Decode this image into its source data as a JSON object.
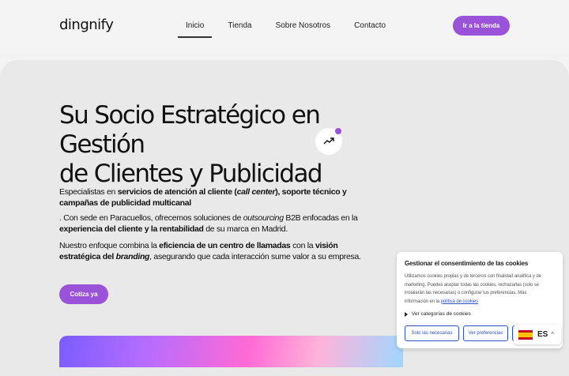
{
  "brand": {
    "logo": "dingnify",
    "accent": "#9a53d8"
  },
  "nav": {
    "items": [
      {
        "label": "Inicio",
        "active": true
      },
      {
        "label": "Tienda",
        "active": false
      },
      {
        "label": "Sobre Nosotros",
        "active": false
      },
      {
        "label": "Contacto",
        "active": false
      }
    ],
    "store_button": "Ir a la tienda"
  },
  "hero": {
    "title_line1": "Su Socio Estratégico en Gestión",
    "title_line2": "de Clientes y Publicidad",
    "trend_icon": "trending-up-icon",
    "p1": {
      "t1": "Especialistas en ",
      "b1": "servicios de atención al cliente (",
      "bi1": "call center",
      "b2": "), soporte técnico y campañas de publicidad multicanal"
    },
    "p2": {
      "t1": ". Con sede en Paracuellos, ofrecemos soluciones de ",
      "i1": "outsourcing",
      "t2": " B2B enfocadas en la ",
      "b1": "experiencia del cliente y la rentabilidad",
      "t3": " de su marca en Madrid."
    },
    "p3": {
      "t1": "Nuestro enfoque combina la ",
      "b1": "eficiencia de un centro de llamadas",
      "t2": " con la ",
      "b2": "visión estratégica del ",
      "bi1": "branding",
      "t3": ", asegurando que cada interacción sume valor a su empresa."
    },
    "cta": "Cotiza ya"
  },
  "cookie": {
    "title": "Gestionar el consentimiento de las cookies",
    "text": "Utilizamos cookies propias y de terceros con finalidad analítica y de marketing. Puedes aceptar todas las cookies, rechazarlas (solo se instalarán las necesarias) o configurar tus preferencias. Más información en la ",
    "link": "política de cookies",
    "categories": "Ver categorías de cookies",
    "btn_necessary": "Solo las necesarias",
    "btn_preferences": "Ver preferencias"
  },
  "language": {
    "code": "ES",
    "flag_icon": "spain-flag-icon"
  }
}
